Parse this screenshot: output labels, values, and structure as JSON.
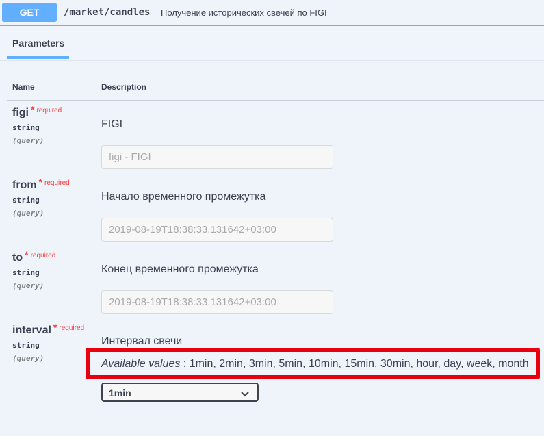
{
  "summary": {
    "method": "GET",
    "path": "/market/candles",
    "description": "Получение исторических свечей по FIGI"
  },
  "tabs": {
    "parameters": "Parameters"
  },
  "columns": {
    "name": "Name",
    "description": "Description"
  },
  "params": [
    {
      "name": "figi",
      "star": "*",
      "required": "required",
      "type": "string",
      "in": "(query)",
      "description": "FIGI",
      "placeholder": "figi - FIGI"
    },
    {
      "name": "from",
      "star": "*",
      "required": "required",
      "type": "string",
      "in": "(query)",
      "description": "Начало временного промежутка",
      "placeholder": "2019-08-19T18:38:33.131642+03:00"
    },
    {
      "name": "to",
      "star": "*",
      "required": "required",
      "type": "string",
      "in": "(query)",
      "description": "Конец временного промежутка",
      "placeholder": "2019-08-19T18:38:33.131642+03:00"
    },
    {
      "name": "interval",
      "star": "*",
      "required": "required",
      "type": "string",
      "in": "(query)",
      "description": "Интервал свечи",
      "available_label": "Available values",
      "available_values": ": 1min, 2min, 3min, 5min, 10min, 15min, 30min, hour, day, week, month",
      "selected": "1min"
    }
  ],
  "colors": {
    "get": "#61affe",
    "required": "#f93e3e",
    "highlight": "#e8000e"
  }
}
